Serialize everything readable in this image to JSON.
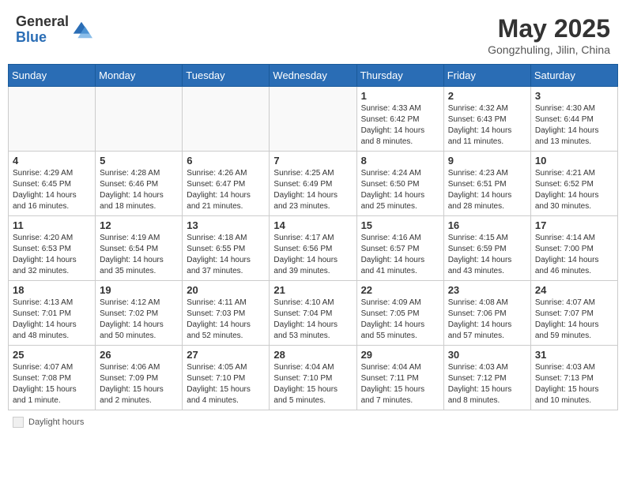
{
  "header": {
    "logo_line1": "General",
    "logo_line2": "Blue",
    "month_year": "May 2025",
    "location": "Gongzhuling, Jilin, China"
  },
  "weekdays": [
    "Sunday",
    "Monday",
    "Tuesday",
    "Wednesday",
    "Thursday",
    "Friday",
    "Saturday"
  ],
  "weeks": [
    [
      {
        "day": "",
        "info": ""
      },
      {
        "day": "",
        "info": ""
      },
      {
        "day": "",
        "info": ""
      },
      {
        "day": "",
        "info": ""
      },
      {
        "day": "1",
        "info": "Sunrise: 4:33 AM\nSunset: 6:42 PM\nDaylight: 14 hours\nand 8 minutes."
      },
      {
        "day": "2",
        "info": "Sunrise: 4:32 AM\nSunset: 6:43 PM\nDaylight: 14 hours\nand 11 minutes."
      },
      {
        "day": "3",
        "info": "Sunrise: 4:30 AM\nSunset: 6:44 PM\nDaylight: 14 hours\nand 13 minutes."
      }
    ],
    [
      {
        "day": "4",
        "info": "Sunrise: 4:29 AM\nSunset: 6:45 PM\nDaylight: 14 hours\nand 16 minutes."
      },
      {
        "day": "5",
        "info": "Sunrise: 4:28 AM\nSunset: 6:46 PM\nDaylight: 14 hours\nand 18 minutes."
      },
      {
        "day": "6",
        "info": "Sunrise: 4:26 AM\nSunset: 6:47 PM\nDaylight: 14 hours\nand 21 minutes."
      },
      {
        "day": "7",
        "info": "Sunrise: 4:25 AM\nSunset: 6:49 PM\nDaylight: 14 hours\nand 23 minutes."
      },
      {
        "day": "8",
        "info": "Sunrise: 4:24 AM\nSunset: 6:50 PM\nDaylight: 14 hours\nand 25 minutes."
      },
      {
        "day": "9",
        "info": "Sunrise: 4:23 AM\nSunset: 6:51 PM\nDaylight: 14 hours\nand 28 minutes."
      },
      {
        "day": "10",
        "info": "Sunrise: 4:21 AM\nSunset: 6:52 PM\nDaylight: 14 hours\nand 30 minutes."
      }
    ],
    [
      {
        "day": "11",
        "info": "Sunrise: 4:20 AM\nSunset: 6:53 PM\nDaylight: 14 hours\nand 32 minutes."
      },
      {
        "day": "12",
        "info": "Sunrise: 4:19 AM\nSunset: 6:54 PM\nDaylight: 14 hours\nand 35 minutes."
      },
      {
        "day": "13",
        "info": "Sunrise: 4:18 AM\nSunset: 6:55 PM\nDaylight: 14 hours\nand 37 minutes."
      },
      {
        "day": "14",
        "info": "Sunrise: 4:17 AM\nSunset: 6:56 PM\nDaylight: 14 hours\nand 39 minutes."
      },
      {
        "day": "15",
        "info": "Sunrise: 4:16 AM\nSunset: 6:57 PM\nDaylight: 14 hours\nand 41 minutes."
      },
      {
        "day": "16",
        "info": "Sunrise: 4:15 AM\nSunset: 6:59 PM\nDaylight: 14 hours\nand 43 minutes."
      },
      {
        "day": "17",
        "info": "Sunrise: 4:14 AM\nSunset: 7:00 PM\nDaylight: 14 hours\nand 46 minutes."
      }
    ],
    [
      {
        "day": "18",
        "info": "Sunrise: 4:13 AM\nSunset: 7:01 PM\nDaylight: 14 hours\nand 48 minutes."
      },
      {
        "day": "19",
        "info": "Sunrise: 4:12 AM\nSunset: 7:02 PM\nDaylight: 14 hours\nand 50 minutes."
      },
      {
        "day": "20",
        "info": "Sunrise: 4:11 AM\nSunset: 7:03 PM\nDaylight: 14 hours\nand 52 minutes."
      },
      {
        "day": "21",
        "info": "Sunrise: 4:10 AM\nSunset: 7:04 PM\nDaylight: 14 hours\nand 53 minutes."
      },
      {
        "day": "22",
        "info": "Sunrise: 4:09 AM\nSunset: 7:05 PM\nDaylight: 14 hours\nand 55 minutes."
      },
      {
        "day": "23",
        "info": "Sunrise: 4:08 AM\nSunset: 7:06 PM\nDaylight: 14 hours\nand 57 minutes."
      },
      {
        "day": "24",
        "info": "Sunrise: 4:07 AM\nSunset: 7:07 PM\nDaylight: 14 hours\nand 59 minutes."
      }
    ],
    [
      {
        "day": "25",
        "info": "Sunrise: 4:07 AM\nSunset: 7:08 PM\nDaylight: 15 hours\nand 1 minute."
      },
      {
        "day": "26",
        "info": "Sunrise: 4:06 AM\nSunset: 7:09 PM\nDaylight: 15 hours\nand 2 minutes."
      },
      {
        "day": "27",
        "info": "Sunrise: 4:05 AM\nSunset: 7:10 PM\nDaylight: 15 hours\nand 4 minutes."
      },
      {
        "day": "28",
        "info": "Sunrise: 4:04 AM\nSunset: 7:10 PM\nDaylight: 15 hours\nand 5 minutes."
      },
      {
        "day": "29",
        "info": "Sunrise: 4:04 AM\nSunset: 7:11 PM\nDaylight: 15 hours\nand 7 minutes."
      },
      {
        "day": "30",
        "info": "Sunrise: 4:03 AM\nSunset: 7:12 PM\nDaylight: 15 hours\nand 8 minutes."
      },
      {
        "day": "31",
        "info": "Sunrise: 4:03 AM\nSunset: 7:13 PM\nDaylight: 15 hours\nand 10 minutes."
      }
    ]
  ],
  "footer": {
    "label": "Daylight hours"
  }
}
